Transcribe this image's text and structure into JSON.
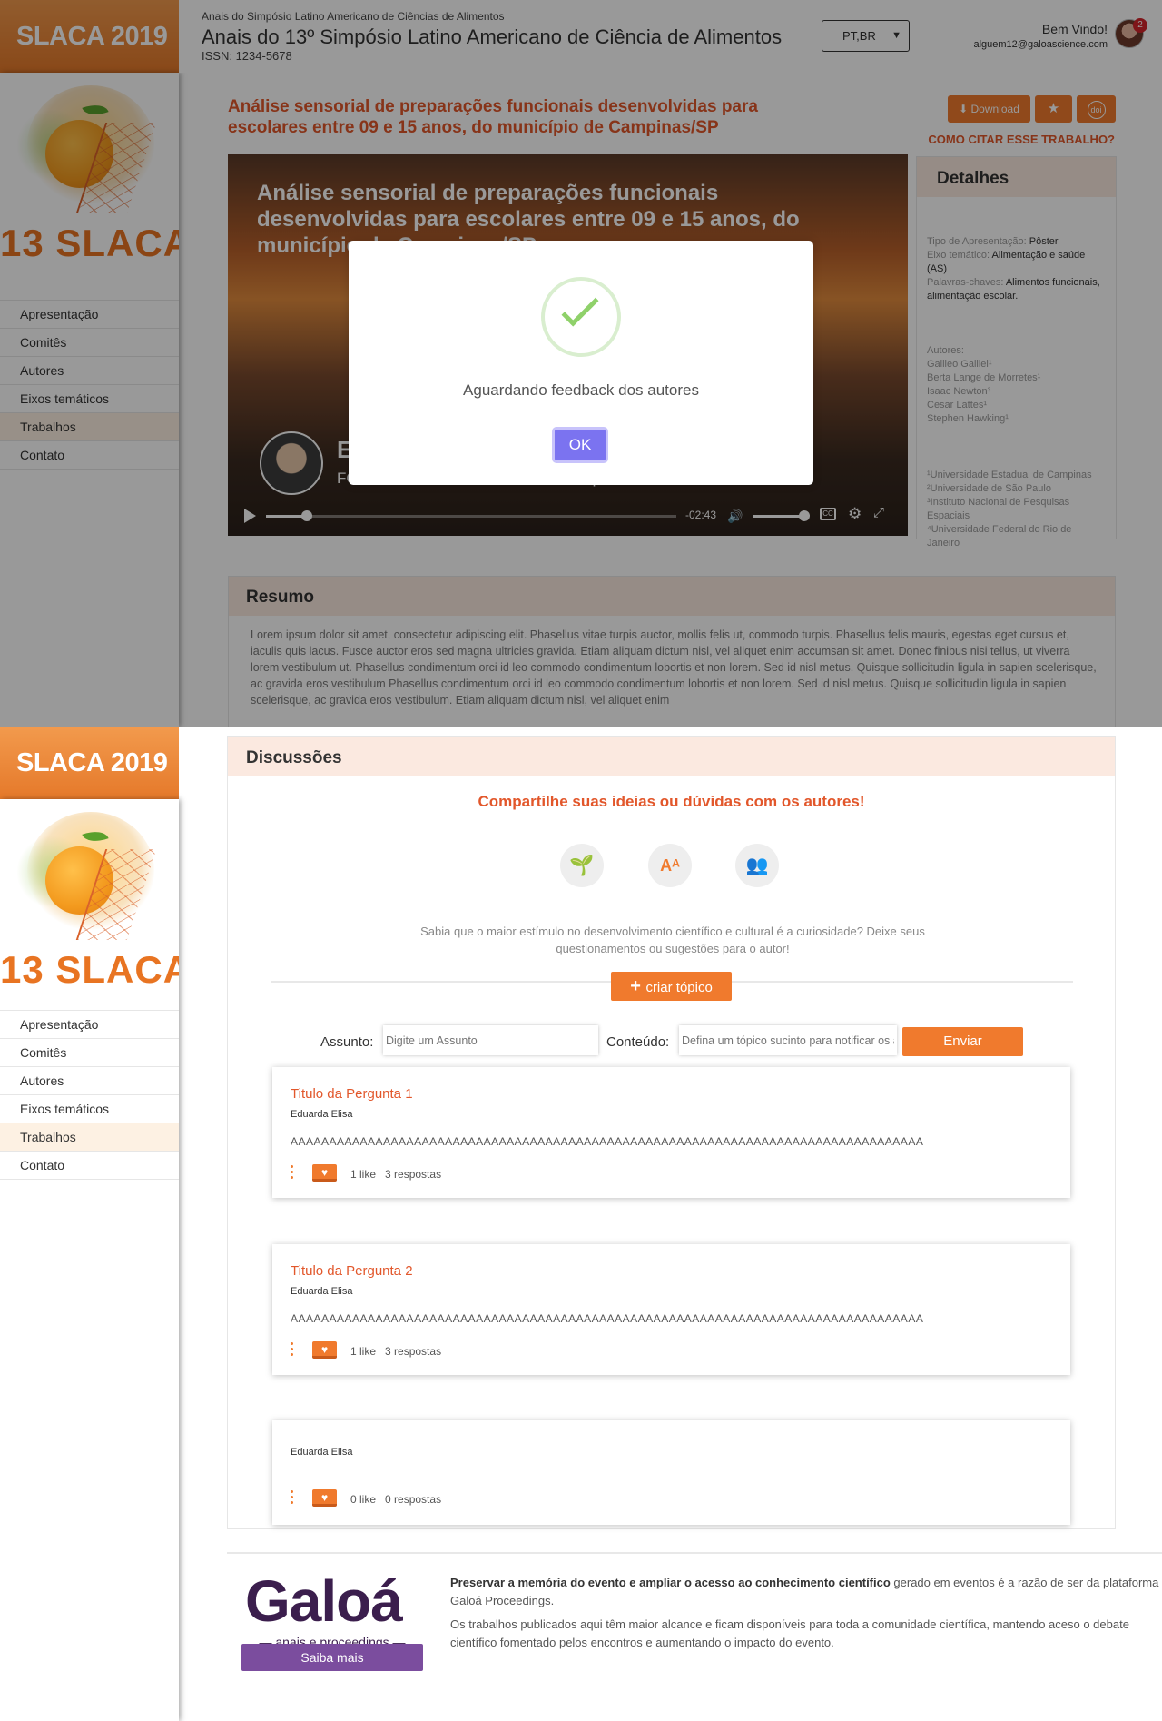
{
  "header": {
    "brand": "SLACA 2019",
    "subtitle": "Anais do Simpósio Latino Americano de Ciências de Alimentos",
    "title": "Anais do 13º Simpósio Latino Americano de Ciência de Alimentos",
    "issn": "ISSN: 1234-5678",
    "language": "PT,BR",
    "welcome": "Bem Vindo!",
    "user_email": "alguem12@galoascience.com",
    "notification_count": "2"
  },
  "logo": {
    "text": "13 SLACA"
  },
  "sidebar": {
    "items": [
      {
        "label": "Apresentação"
      },
      {
        "label": "Comitês"
      },
      {
        "label": "Autores"
      },
      {
        "label": "Eixos temáticos"
      },
      {
        "label": "Trabalhos"
      },
      {
        "label": "Contato"
      }
    ],
    "active_index": 4
  },
  "work": {
    "title": "Análise sensorial de preparações funcionais desenvolvidas para escolares entre 09 e 15 anos, do município de Campinas/SP",
    "download_label": "Download",
    "doi_label": "doi",
    "cite_label": "COMO CITAR ESSE TRABALHO?"
  },
  "video": {
    "title": "Análise sensorial de preparações funcionais desenvolvidas para escolares entre 09 e 15 anos, do município de Campinas/SP",
    "author_name": "E",
    "author_affiliation": "FCA / Universidade Estadual de Campinas",
    "time": "-02:43",
    "progress": 0.1,
    "volume": 0.8
  },
  "details": {
    "heading": "Detalhes",
    "type_label": "Tipo de Apresentação:",
    "type_value": "Pôster",
    "axis_label": "Eixo temático:",
    "axis_value": "Alimentação e saúde (AS)",
    "keywords_label": "Palavras-chaves:",
    "keywords_value": "Alimentos funcionais, alimentação escolar.",
    "authors_label": "Autores:",
    "authors": [
      "Galileo Galilei¹",
      "Berta Lange de Morretes¹",
      "Isaac Newton³",
      "Cesar Lattes¹",
      "Stephen Hawking¹"
    ],
    "institutions": [
      "¹Universidade Estadual de Campinas",
      "²Universidade de São Paulo",
      "³Instituto Nacional de Pesquisas Espaciais",
      "⁴Universidade Federal do Rio de Janeiro"
    ]
  },
  "resumo": {
    "heading": "Resumo",
    "text": "Lorem ipsum dolor sit amet, consectetur adipiscing elit. Phasellus vitae turpis auctor, mollis felis ut, commodo turpis. Phasellus felis mauris, egestas eget cursus et, iaculis quis lacus. Fusce auctor eros sed magna ultricies gravida. Etiam aliquam dictum nisl, vel aliquet enim accumsan sit amet. Donec finibus nisi tellus, ut viverra lorem vestibulum ut. Phasellus condimentum orci id leo commodo condimentum lobortis et non lorem. Sed id nisl metus. Quisque sollicitudin ligula in sapien scelerisque, ac gravida eros vestibulum Phasellus condimentum orci id leo commodo condimentum lobortis et non lorem. Sed id nisl metus. Quisque sollicitudin ligula in sapien scelerisque, ac gravida eros vestibulum. Etiam aliquam dictum nisl, vel aliquet enim"
  },
  "modal": {
    "message": "Aguardando feedback dos autores",
    "ok_label": "OK"
  },
  "discussions": {
    "heading": "Discussões",
    "share_title": "Compartilhe suas ideias ou dúvidas com os autores!",
    "hint": "Sabia que o maior estímulo no desenvolvimento científico e cultural é a curiosidade? Deixe seus questionamentos ou sugestões para o autor!",
    "new_topic_label": "criar tópico",
    "subject_label": "Assunto:",
    "subject_placeholder": "Digite um Assunto",
    "content_label": "Conteúdo:",
    "content_placeholder": "Defina um tópico sucinto para notificar os autores",
    "send_label": "Enviar",
    "topics": [
      {
        "title": "Titulo da Pergunta 1",
        "author": "Eduarda Elisa",
        "body": "AAAAAAAAAAAAAAAAAAAAAAAAAAAAAAAAAAAAAAAAAAAAAAAAAAAAAAAAAAAAAAAAAAAAAAAAAAAAAAAAAA",
        "likes": "1 like",
        "replies": "3 respostas"
      },
      {
        "title": "Titulo da Pergunta 2",
        "author": "Eduarda Elisa",
        "body": "AAAAAAAAAAAAAAAAAAAAAAAAAAAAAAAAAAAAAAAAAAAAAAAAAAAAAAAAAAAAAAAAAAAAAAAAAAAAAAAAAA",
        "likes": "1 like",
        "replies": "3 respostas"
      },
      {
        "title": "",
        "author": "Eduarda Elisa",
        "body": "",
        "likes": "0 like",
        "replies": "0 respostas"
      }
    ]
  },
  "footer": {
    "brand": "Galoá",
    "tagline": "anais e proceedings",
    "button_label": "Saiba mais",
    "lead_bold": "Preservar a memória do evento e ampliar o acesso ao conhecimento científico",
    "lead_rest": " gerado em eventos é a razão de ser da plataforma Galoá Proceedings.",
    "second": "Os trabalhos publicados aqui têm maior alcance e ficam disponíveis para toda a comunidade científica, mantendo aceso o debate científico fomentado pelos encontros e aumentando o impacto do evento."
  }
}
